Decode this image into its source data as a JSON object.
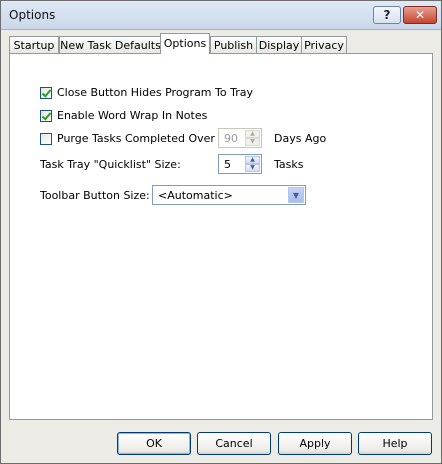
{
  "window": {
    "title": "Options",
    "help_label": "?",
    "close_label": "✕"
  },
  "tabs": [
    {
      "label": "Startup",
      "active": false
    },
    {
      "label": "New Task Defaults",
      "active": false
    },
    {
      "label": "Options",
      "active": true
    },
    {
      "label": "Publish",
      "active": false
    },
    {
      "label": "Display",
      "active": false
    },
    {
      "label": "Privacy",
      "active": false
    }
  ],
  "options": {
    "close_hides": {
      "label": "Close Button Hides Program To Tray",
      "checked": true
    },
    "word_wrap": {
      "label": "Enable Word Wrap In Notes",
      "checked": true
    },
    "purge": {
      "label": "Purge Tasks Completed Over",
      "checked": false,
      "value": "90",
      "suffix": "Days Ago"
    },
    "quicklist": {
      "label": "Task Tray \"Quicklist\" Size:",
      "value": "5",
      "suffix": "Tasks"
    },
    "toolbar_size": {
      "label": "Toolbar Button Size:",
      "selected": "<Automatic>"
    }
  },
  "buttons": {
    "ok": "OK",
    "cancel": "Cancel",
    "apply": "Apply",
    "help": "Help"
  },
  "icons": {
    "spin_up": "▲",
    "spin_down": "▼",
    "dropdown": "▼"
  }
}
